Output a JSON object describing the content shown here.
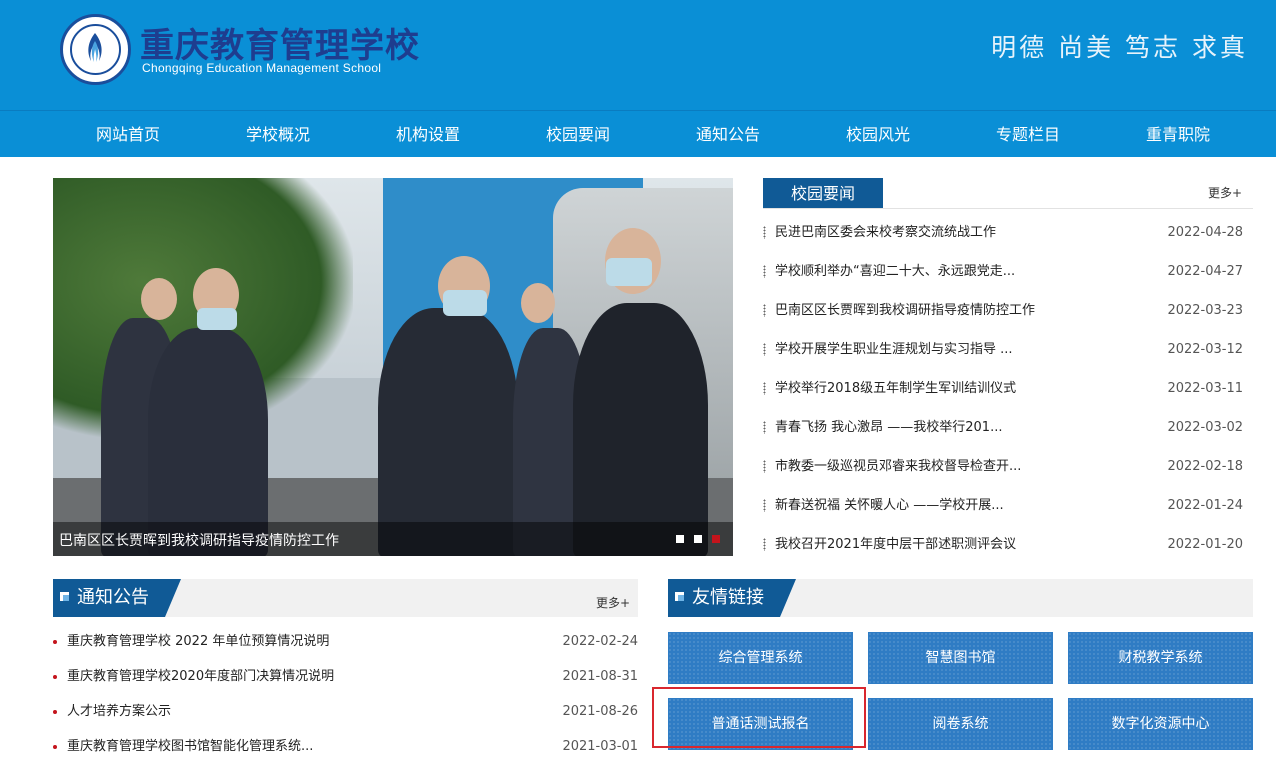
{
  "header": {
    "school_name_cn": "重庆教育管理学校",
    "school_name_en": "Chongqing Education Management School",
    "motto": "明德 尚美 笃志 求真"
  },
  "nav": [
    "网站首页",
    "学校概况",
    "机构设置",
    "校园要闻",
    "通知公告",
    "校园风光",
    "专题栏目",
    "重青职院"
  ],
  "slider": {
    "caption": "巴南区区长贾晖到我校调研指导疫情防控工作",
    "dot_count": 3,
    "active_dot": 3
  },
  "campus_news": {
    "title": "校园要闻",
    "more": "更多+",
    "items": [
      {
        "title": "民进巴南区委会来校考察交流统战工作",
        "date": "2022-04-28"
      },
      {
        "title": "学校顺利举办“喜迎二十大、永远跟党走...",
        "date": "2022-04-27"
      },
      {
        "title": "巴南区区长贾晖到我校调研指导疫情防控工作",
        "date": "2022-03-23"
      },
      {
        "title": "学校开展学生职业生涯规划与实习指导 ...",
        "date": "2022-03-12"
      },
      {
        "title": "学校举行2018级五年制学生军训结训仪式",
        "date": "2022-03-11"
      },
      {
        "title": "青春飞扬 我心激昂 ——我校举行201...",
        "date": "2022-03-02"
      },
      {
        "title": "市教委一级巡视员邓睿来我校督导检查开...",
        "date": "2022-02-18"
      },
      {
        "title": "新春送祝福 关怀暖人心 ——学校开展...",
        "date": "2022-01-24"
      },
      {
        "title": "我校召开2021年度中层干部述职测评会议",
        "date": "2022-01-20"
      }
    ]
  },
  "notices": {
    "title": "通知公告",
    "more": "更多+",
    "items": [
      {
        "title": "重庆教育管理学校 2022 年单位预算情况说明",
        "date": "2022-02-24"
      },
      {
        "title": "重庆教育管理学校2020年度部门决算情况说明",
        "date": "2021-08-31"
      },
      {
        "title": "人才培养方案公示",
        "date": "2021-08-26"
      },
      {
        "title": "重庆教育管理学校图书馆智能化管理系统...",
        "date": "2021-03-01"
      }
    ]
  },
  "links": {
    "title": "友情链接",
    "items": [
      "综合管理系统",
      "智慧图书馆",
      "财税教学系统",
      "普通话测试报名",
      "阅卷系统",
      "数字化资源中心"
    ]
  },
  "colors": {
    "header_blue": "#0a8fd6",
    "dark_blue": "#105a96",
    "button_blue": "#2f7cc4",
    "highlight_red": "#d9272e"
  }
}
